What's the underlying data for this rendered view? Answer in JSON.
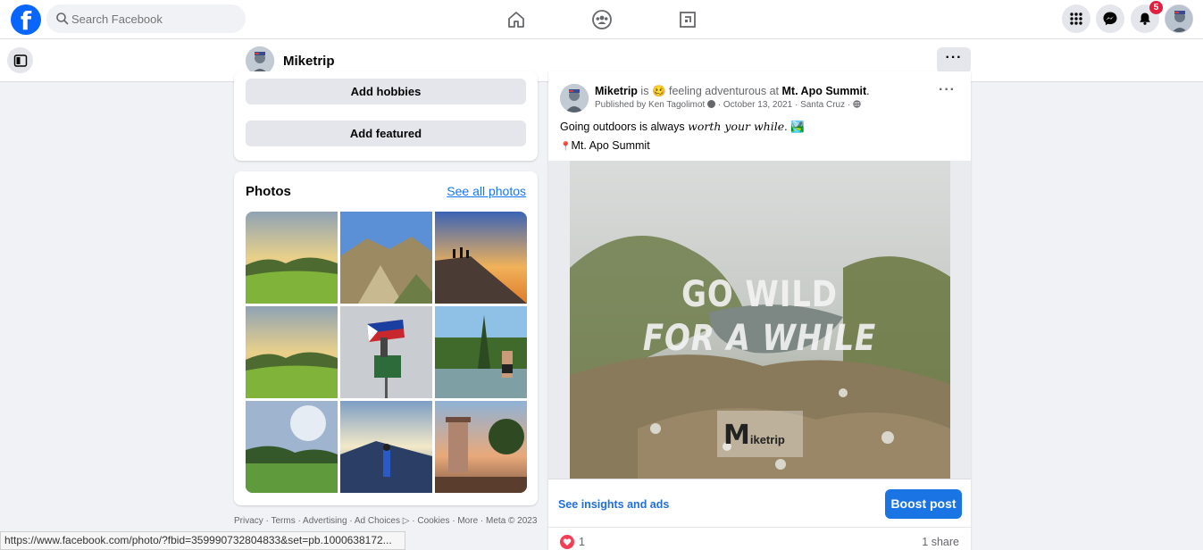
{
  "topbar": {
    "logo_text": "f",
    "search_placeholder": "Search Facebook",
    "notification_count": "5"
  },
  "profile_header": {
    "name": "Miketrip",
    "more_label": "···"
  },
  "intro_card": {
    "add_hobbies": "Add hobbies",
    "add_featured": "Add featured"
  },
  "photos_card": {
    "title": "Photos",
    "see_all": "See all photos"
  },
  "footer": {
    "links": "Privacy · Terms · Advertising · Ad Choices ▷ · Cookies · More · Meta © 2023"
  },
  "status_bar": {
    "url": "https://www.facebook.com/photo/?fbid=359990732804833&set=pb.1000638172..."
  },
  "post": {
    "author": "Miketrip",
    "is_text": "is",
    "feeling_emoji": "🥴",
    "feeling_text": "feeling adventurous at",
    "location": "Mt. Apo Summit",
    "period": ".",
    "published_by": "Published by Ken Tagolimot",
    "date": "October 13, 2021",
    "place": "Santa Cruz",
    "dots": "···",
    "text_line1_prefix": "Going outdoors is always ",
    "text_line1_italic": "worth your while",
    "text_line1_suffix": ". 🏞️",
    "pin_emoji": "📍",
    "text_line2": "Mt. Apo Summit",
    "image_line1": "GO WILD",
    "image_line2": "FOR A WHILE",
    "image_watermark": "iketrip",
    "watermark_letter": "M",
    "insights_link": "See insights and ads",
    "boost_label": "Boost post",
    "reaction_count": "1",
    "share_count": "1 share"
  },
  "colors": {
    "brand_blue": "#0866ff",
    "link_blue": "#1877f2",
    "badge_red": "#e41e3f",
    "background": "#f0f2f5"
  }
}
